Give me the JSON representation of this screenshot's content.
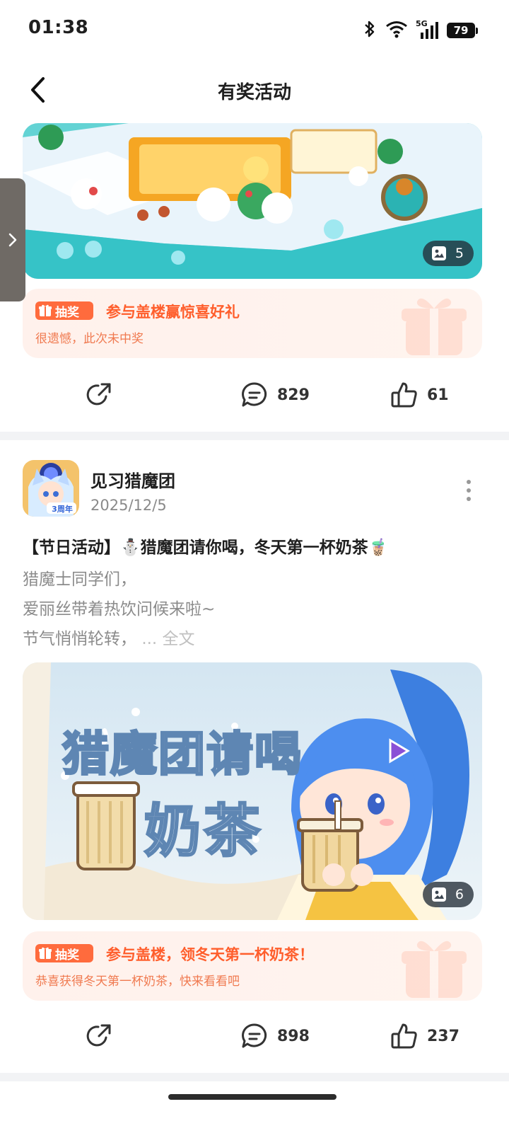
{
  "status_bar": {
    "time": "01:38",
    "network": "5G",
    "battery": "79"
  },
  "nav": {
    "title": "有奖活动"
  },
  "posts": [
    {
      "image_count": "5",
      "lottery": {
        "badge": "抽奖",
        "title": "参与盖楼赢惊喜好礼",
        "status": "很遗憾，此次未中奖"
      },
      "stats": {
        "comments": "829",
        "likes": "61"
      }
    },
    {
      "author": "见习猎魔团",
      "avatar_badge": "3周年",
      "date": "2025/12/5",
      "title": "【节日活动】⛄猎魔团请你喝，冬天第一杯奶茶🧋",
      "body_lines": [
        "猎魔士同学们，",
        "爱丽丝带着热饮问候来啦~",
        "节气悄悄轮转，"
      ],
      "read_more": "... 全文",
      "banner_text_1": "猎魔团请喝",
      "banner_text_2": "奶茶",
      "image_count": "6",
      "lottery": {
        "badge": "抽奖",
        "title": "参与盖楼，领冬天第一杯奶茶！",
        "status": "恭喜获得冬天第一杯奶茶，快来看看吧"
      },
      "stats": {
        "comments": "898",
        "likes": "237"
      }
    }
  ],
  "colors": {
    "accent": "#ff6b3d",
    "lottery_bg": "#fff1ec",
    "divider": "#f2f3f5"
  },
  "icons": [
    "bluetooth-icon",
    "wifi-icon",
    "signal-icon",
    "battery-icon",
    "back-icon",
    "chevron-right-icon",
    "image-icon",
    "gift-icon",
    "share-icon",
    "comment-icon",
    "like-icon",
    "more-icon"
  ]
}
